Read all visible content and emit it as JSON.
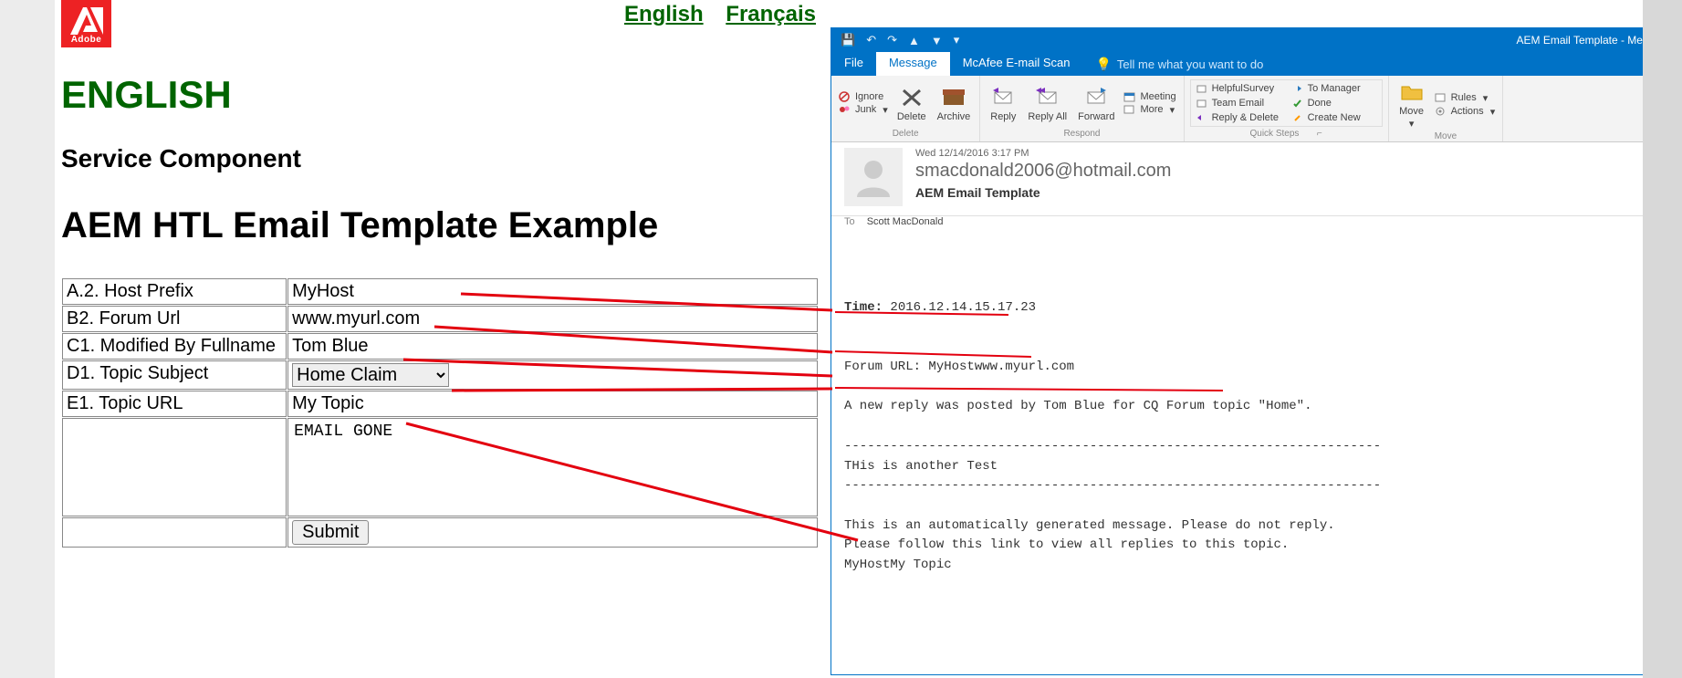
{
  "page": {
    "lang": {
      "en": "English",
      "fr": "Français"
    },
    "adobe": "Adobe",
    "heading": "ENGLISH",
    "subheading": "Service Component",
    "title": "AEM HTL Email Template Example"
  },
  "form": {
    "rows": [
      {
        "label": "A.2. Host Prefix",
        "value": "MyHost"
      },
      {
        "label": "B2. Forum Url",
        "value": "www.myurl.com"
      },
      {
        "label": "C1. Modified By Fullname",
        "value": "Tom Blue"
      },
      {
        "label": "D1. Topic Subject",
        "value": "Home Claim"
      },
      {
        "label": "E1. Topic URL",
        "value": "My Topic"
      }
    ],
    "textarea": "EMAIL GONE",
    "submit": "Submit"
  },
  "outlook": {
    "title": "AEM Email Template - Message",
    "qat": {
      "save": "💾",
      "undo": "↶",
      "redo": "↷",
      "prev": "▲",
      "next": "▼",
      "more": "▾"
    },
    "tabs": {
      "file": "File",
      "message": "Message",
      "mcafee": "McAfee E-mail Scan",
      "tell": "Tell me what you want to do"
    },
    "ribbon": {
      "delete": {
        "ignore": "Ignore",
        "junk": "Junk",
        "delete": "Delete",
        "archive": "Archive",
        "group": "Delete"
      },
      "respond": {
        "reply": "Reply",
        "replyall": "Reply All",
        "forward": "Forward",
        "meeting": "Meeting",
        "more": "More",
        "group": "Respond"
      },
      "quicksteps": {
        "items": [
          "HelpfulSurvey",
          "Team Email",
          "Reply & Delete",
          "To Manager",
          "Done",
          "Create New"
        ],
        "group": "Quick Steps"
      },
      "move": {
        "move": "Move",
        "rules": "Rules",
        "actions": "Actions",
        "group": "Move"
      }
    },
    "header": {
      "date": "Wed 12/14/2016 3:17 PM",
      "from": "smacdonald2006@hotmail.com",
      "subject": "AEM Email Template",
      "toLabel": "To",
      "toName": "Scott MacDonald"
    },
    "body": {
      "timeLabel": "Time:",
      "time": "2016.12.14.15.17.23",
      "forumLabel": "Forum URL:",
      "forum": "MyHostwww.myurl.com",
      "reply": "A new reply was posted by Tom Blue for CQ Forum topic \"Home\".",
      "sep": "----------------------------------------------------------------------",
      "test": "THis is another Test",
      "auto": "This is an automatically generated message. Please do not reply.",
      "follow": "Please follow this link to view all replies to this topic.",
      "link": "MyHostMy Topic"
    }
  }
}
